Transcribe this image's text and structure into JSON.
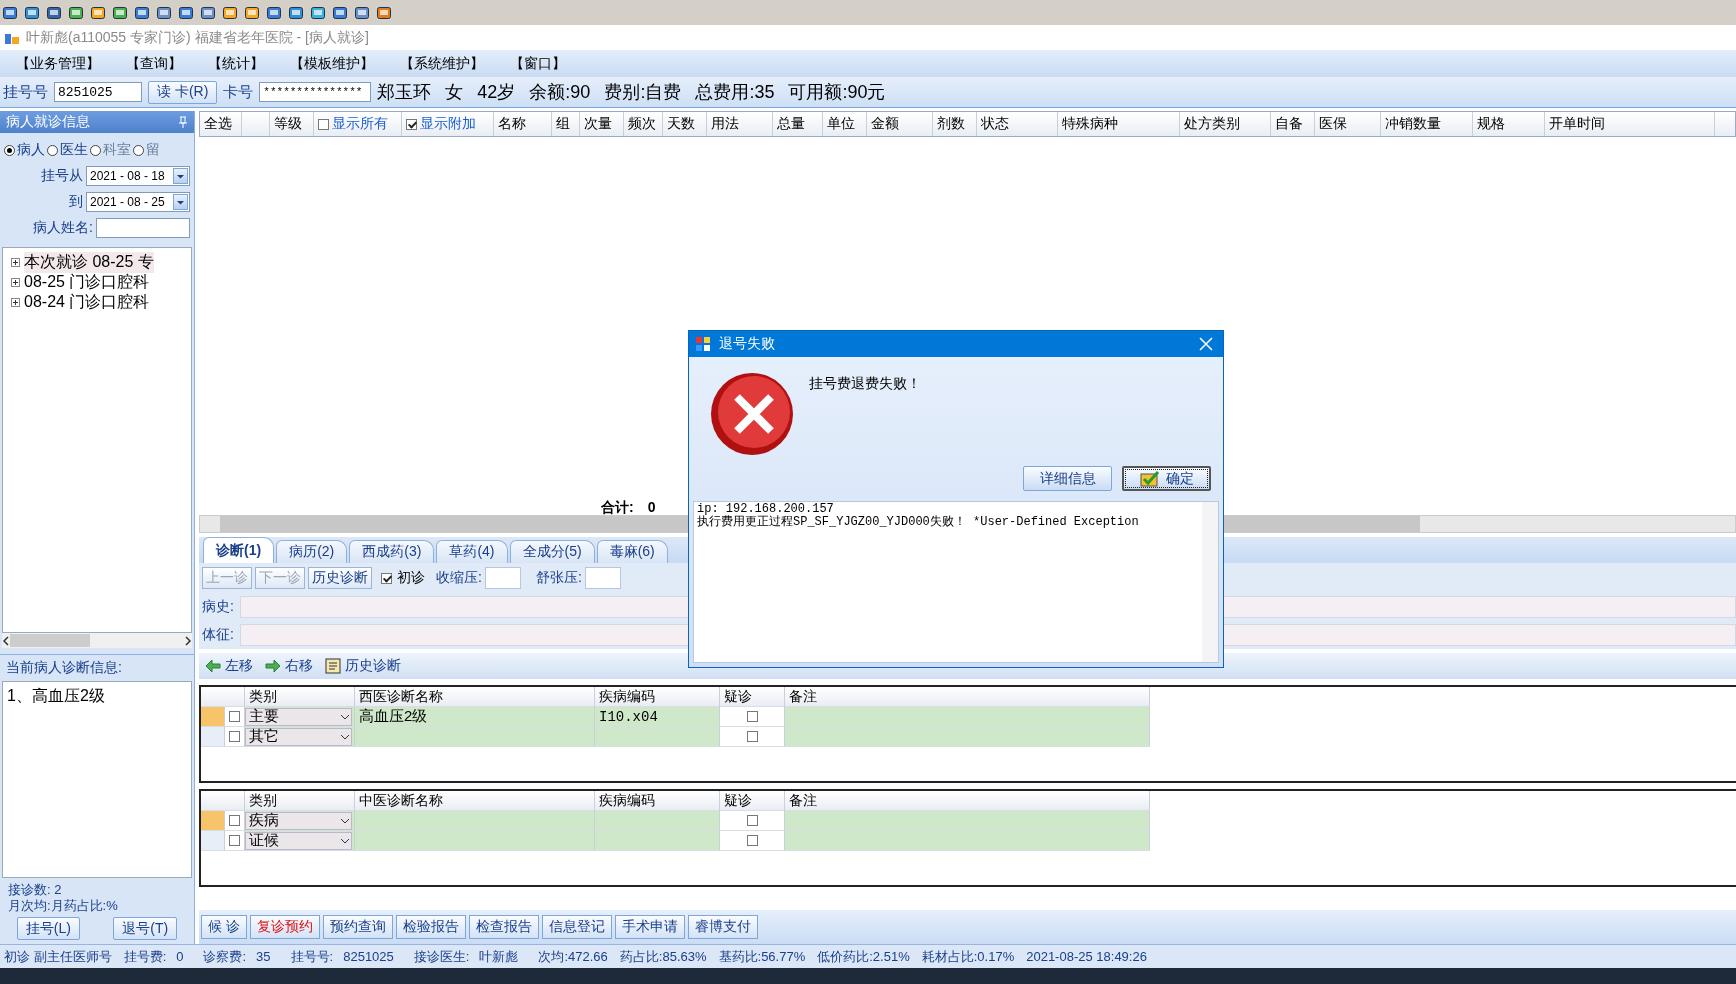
{
  "window": {
    "title": "叶新彪(a110055 专家门诊) 福建省老年医院 - [病人就诊]"
  },
  "menu": [
    "【业务管理】",
    "【查询】",
    "【统计】",
    "【模板维护】",
    "【系统维护】",
    "【窗口】"
  ],
  "patient_bar": {
    "reg_label": "挂号号",
    "reg_value": "8251025",
    "read_card_button": "读 卡(R)",
    "card_label": "卡号",
    "card_value": "***************",
    "info": [
      "郑玉环",
      "女",
      "42岁",
      "余额:90",
      "费别:自费",
      "总费用:35",
      "可用额:90元"
    ]
  },
  "sidebar": {
    "title": "病人就诊信息",
    "filters": [
      {
        "label": "病人",
        "selected": true
      },
      {
        "label": "医生",
        "selected": false
      },
      {
        "label": "科室",
        "selected": false
      },
      {
        "label": "留",
        "selected": false
      }
    ],
    "date_from_label": "挂号从",
    "date_from": "2021 - 08 - 18",
    "date_to_label": "到",
    "date_to": "2021 - 08 - 25",
    "name_label": "病人姓名:",
    "visits": [
      {
        "label": "本次就诊  08-25  专",
        "expanded": false,
        "selected": true
      },
      {
        "label": "08-25  门诊口腔科",
        "expanded": false,
        "selected": false
      },
      {
        "label": "08-24  门诊口腔科",
        "expanded": false,
        "selected": false
      }
    ],
    "diagnosis_title": "当前病人诊断信息:",
    "diagnosis_text": "1、高血压2级",
    "visit_count": "接诊数: 2",
    "monthly": "月次均:月药占比:%",
    "buttons": [
      "挂号(L)",
      "退号(T)"
    ]
  },
  "orders": {
    "columns": [
      {
        "label": "全选",
        "kind": "text"
      },
      {
        "kind": "blank"
      },
      {
        "label": "等级",
        "kind": "text"
      },
      {
        "label": "显示所有",
        "kind": "check",
        "checked": false
      },
      {
        "label": "显示附加",
        "kind": "check",
        "checked": true
      },
      {
        "label": "名称",
        "kind": "text"
      },
      {
        "label": "组",
        "kind": "text"
      },
      {
        "label": "次量",
        "kind": "text"
      },
      {
        "label": "频次",
        "kind": "text"
      },
      {
        "label": "天数",
        "kind": "text"
      },
      {
        "label": "用法",
        "kind": "text"
      },
      {
        "label": "总量",
        "kind": "text"
      },
      {
        "label": "单位",
        "kind": "text"
      },
      {
        "label": "金额",
        "kind": "text"
      },
      {
        "label": "剂数",
        "kind": "text"
      },
      {
        "label": "状态",
        "kind": "text"
      },
      {
        "label": "特殊病种",
        "kind": "text"
      },
      {
        "label": "处方类别",
        "kind": "text"
      },
      {
        "label": "自备",
        "kind": "text"
      },
      {
        "label": "医保",
        "kind": "text"
      },
      {
        "label": "冲销数量",
        "kind": "text"
      },
      {
        "label": "规格",
        "kind": "text"
      },
      {
        "label": "开单时间",
        "kind": "text"
      }
    ],
    "total_label": "合计:",
    "total_value": "0"
  },
  "tabs": [
    {
      "label": "诊断(1)",
      "selected": true
    },
    {
      "label": "病历(2)",
      "selected": false
    },
    {
      "label": "西成药(3)",
      "selected": false
    },
    {
      "label": "草药(4)",
      "selected": false
    },
    {
      "label": "全成分(5)",
      "selected": false
    },
    {
      "label": "毒麻(6)",
      "selected": false
    }
  ],
  "diag_toolbar": {
    "buttons": [
      {
        "label": "上一诊",
        "disabled": true
      },
      {
        "label": "下一诊",
        "disabled": true
      },
      {
        "label": "历史诊断",
        "disabled": false
      }
    ],
    "first_visit": {
      "label": "初诊",
      "checked": true
    },
    "systolic_label": "收缩压:",
    "diastolic_label": "舒张压:",
    "history_label": "病史:",
    "signs_label": "体征:"
  },
  "move_toolbar": [
    {
      "label": "左移",
      "kind": "left"
    },
    {
      "label": "右移",
      "kind": "right"
    },
    {
      "label": "历史诊断",
      "kind": "history"
    }
  ],
  "western_table": {
    "columns": [
      "类别",
      "西医诊断名称",
      "疾病编码",
      "疑诊",
      "备注"
    ],
    "rows": [
      {
        "selected": true,
        "checked": false,
        "category": "主要",
        "name": "高血压2级",
        "code": "I10.x04",
        "suspected": false
      },
      {
        "selected": false,
        "checked": false,
        "category": "其它",
        "suspected": false
      }
    ]
  },
  "tcm_table": {
    "columns": [
      "类别",
      "中医诊断名称",
      "疾病编码",
      "疑诊",
      "备注"
    ],
    "rows": [
      {
        "selected": true,
        "checked": false,
        "category": "疾病",
        "suspected": false
      },
      {
        "selected": false,
        "checked": false,
        "category": "证候",
        "suspected": false
      }
    ]
  },
  "action_buttons": [
    {
      "label": "候 诊",
      "highlight": false
    },
    {
      "label": "复诊预约",
      "highlight": true
    },
    {
      "label": "预约查询",
      "highlight": false
    },
    {
      "label": "检验报告",
      "highlight": false
    },
    {
      "label": "检查报告",
      "highlight": false
    },
    {
      "label": "信息登记",
      "highlight": false
    },
    {
      "label": "手术申请",
      "highlight": false
    },
    {
      "label": "睿博支付",
      "highlight": false
    }
  ],
  "status_bar": [
    {
      "label": "初诊 副主任医师号"
    },
    {
      "label": "挂号费:",
      "value": "0"
    },
    {
      "label": "诊察费:",
      "value": "35"
    },
    {
      "label": "挂号号:",
      "value": "8251025"
    },
    {
      "label": "接诊医生:",
      "value": "叶新彪"
    },
    {
      "label": "次均:472.66"
    },
    {
      "label": "药占比:85.63%"
    },
    {
      "label": "基药比:56.77%"
    },
    {
      "label": "低价药比:2.51%"
    },
    {
      "label": "耗材占比:0.17%"
    },
    {
      "label": "2021-08-25 18:49:26"
    }
  ],
  "dialog": {
    "title": "退号失败",
    "message": "挂号费退费失败！",
    "buttons": [
      {
        "label": "详细信息",
        "default": false,
        "kind": "plain"
      },
      {
        "label": "确定",
        "default": true,
        "kind": "ok"
      }
    ],
    "details": [
      "ip: 192.168.200.157",
      "执行费用更正过程SP_SF_YJGZ00_YJD000失败！ *User-Defined Exception"
    ]
  }
}
